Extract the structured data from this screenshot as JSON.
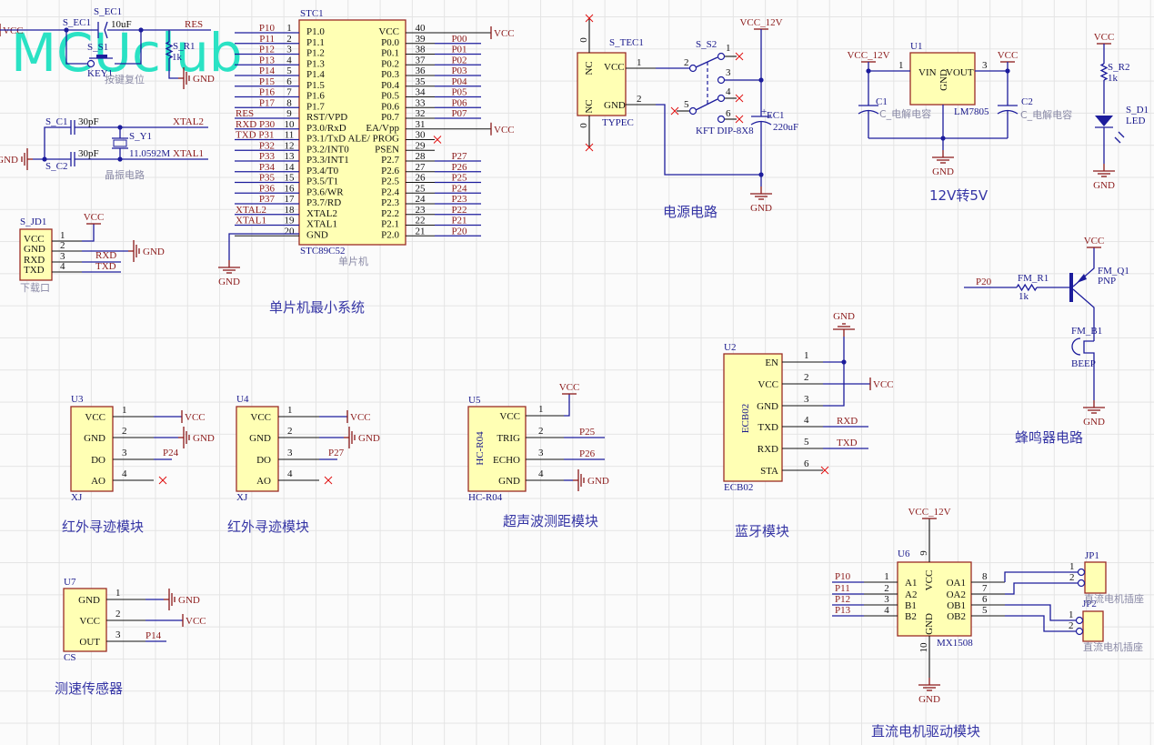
{
  "watermark": "MCUclub",
  "titles": {
    "mcu_system": "单片机最小系统",
    "power": "电源电路",
    "regulator": "12V转5V",
    "buzzer": "蜂鸣器电路",
    "ir1": "红外寻迹模块",
    "ir2": "红外寻迹模块",
    "ultrasonic": "超声波测距模块",
    "bluetooth": "蓝牙模块",
    "speed": "测速传感器",
    "motor": "直流电机驱动模块"
  },
  "reset": {
    "vcc": "VCC",
    "cap": "S_EC1",
    "cap_val": "10uF",
    "net": "RES",
    "switch": "S_S1",
    "switch_part": "KEY1",
    "res": "S_R1",
    "res_val": "1k",
    "gnd": "GND",
    "caption": "按键复位"
  },
  "crystal": {
    "c1": "S_C1",
    "c1_val": "30pF",
    "c2": "S_C2",
    "c2_val": "30pF",
    "xtal": "S_Y1",
    "xtal_val": "11.0592M",
    "net2": "XTAL2",
    "net1": "XTAL1",
    "gnd": "GND",
    "caption": "晶振电路"
  },
  "jd1": {
    "ref": "S_JD1",
    "caption": "下载口",
    "vcc": "VCC",
    "gnd": "GND",
    "rxd": "RXD",
    "txd": "TXD",
    "pins": [
      {
        "n": "1",
        "name": "VCC"
      },
      {
        "n": "2",
        "name": "GND"
      },
      {
        "n": "3",
        "name": "RXD"
      },
      {
        "n": "4",
        "name": "TXD"
      }
    ]
  },
  "mcu": {
    "ref": "STC1",
    "part": "STC89C52",
    "caption": "单片机",
    "gnd": "GND",
    "left": [
      {
        "n": "1",
        "name": "P1.0",
        "net": "P10"
      },
      {
        "n": "2",
        "name": "P1.1",
        "net": "P11"
      },
      {
        "n": "3",
        "name": "P1.2",
        "net": "P12"
      },
      {
        "n": "4",
        "name": "P1.3",
        "net": "P13"
      },
      {
        "n": "5",
        "name": "P1.4",
        "net": "P14"
      },
      {
        "n": "6",
        "name": "P1.5",
        "net": "P15"
      },
      {
        "n": "7",
        "name": "P1.6",
        "net": "P16"
      },
      {
        "n": "8",
        "name": "P1.7",
        "net": "P17"
      },
      {
        "n": "9",
        "name": "RST/VPD",
        "net": "RES"
      },
      {
        "n": "10",
        "name": "P3.0/RxD",
        "net": "RXD P30"
      },
      {
        "n": "11",
        "name": "P3.1/TxD",
        "net": "TXD P31"
      },
      {
        "n": "12",
        "name": "P3.2/INT0",
        "net": "P32"
      },
      {
        "n": "13",
        "name": "P3.3/INT1",
        "net": "P33"
      },
      {
        "n": "14",
        "name": "P3.4/T0",
        "net": "P34"
      },
      {
        "n": "15",
        "name": "P3.5/T1",
        "net": "P35"
      },
      {
        "n": "16",
        "name": "P3.6/WR",
        "net": "P36"
      },
      {
        "n": "17",
        "name": "P3.7/RD",
        "net": "P37"
      },
      {
        "n": "18",
        "name": "XTAL2",
        "net": "XTAL2"
      },
      {
        "n": "19",
        "name": "XTAL1",
        "net": "XTAL1"
      },
      {
        "n": "20",
        "name": "GND",
        "net": ""
      }
    ],
    "right": [
      {
        "n": "40",
        "name": "VCC",
        "net": "VCC"
      },
      {
        "n": "39",
        "name": "P0.0",
        "net": "P00"
      },
      {
        "n": "38",
        "name": "P0.1",
        "net": "P01"
      },
      {
        "n": "37",
        "name": "P0.2",
        "net": "P02"
      },
      {
        "n": "36",
        "name": "P0.3",
        "net": "P03"
      },
      {
        "n": "35",
        "name": "P0.4",
        "net": "P04"
      },
      {
        "n": "34",
        "name": "P0.5",
        "net": "P05"
      },
      {
        "n": "33",
        "name": "P0.6",
        "net": "P06"
      },
      {
        "n": "32",
        "name": "P0.7",
        "net": "P07"
      },
      {
        "n": "31",
        "name": "EA/Vpp",
        "net": "VCC"
      },
      {
        "n": "30",
        "name": "ALE/ PROG",
        "net": ""
      },
      {
        "n": "29",
        "name": "PSEN",
        "net": ""
      },
      {
        "n": "28",
        "name": "P2.7",
        "net": "P27"
      },
      {
        "n": "27",
        "name": "P2.6",
        "net": "P26"
      },
      {
        "n": "26",
        "name": "P2.5",
        "net": "P25"
      },
      {
        "n": "25",
        "name": "P2.4",
        "net": "P24"
      },
      {
        "n": "24",
        "name": "P2.3",
        "net": "P23"
      },
      {
        "n": "23",
        "name": "P2.2",
        "net": "P22"
      },
      {
        "n": "22",
        "name": "P2.1",
        "net": "P21"
      },
      {
        "n": "21",
        "name": "P2.0",
        "net": "P20"
      }
    ]
  },
  "power": {
    "ref": "S_TEC1",
    "part": "TYPEC",
    "nc": "NC",
    "zero": "0",
    "pins": [
      {
        "n": "1",
        "name": "VCC"
      },
      {
        "n": "2",
        "name": "GND"
      }
    ],
    "switch": "S_S2",
    "switch_part": "KFT DIP-8X8",
    "switch_pins": [
      "1",
      "2",
      "3",
      "4",
      "5",
      "6"
    ],
    "cap": "EC1",
    "cap_val": "220uF",
    "vcc12": "VCC_12V",
    "gnd": "GND"
  },
  "reg": {
    "ref": "U1",
    "part": "LM7805",
    "vin": "VIN",
    "vout": "VOUT",
    "gnd_pin": "GND",
    "pin1": "1",
    "pin3": "3",
    "vin_net": "VCC_12V",
    "vout_net": "VCC",
    "c1": "C1",
    "c1_val": "C_电解电容",
    "c2": "C2",
    "c2_val": "C_电解电容",
    "gnd": "GND"
  },
  "led": {
    "vcc": "VCC",
    "res": "S_R2",
    "res_val": "1k",
    "led": "S_D1",
    "led_val": "LED",
    "gnd": "GND"
  },
  "buzzer": {
    "net": "P20",
    "res": "FM_R1",
    "res_val": "1k",
    "q": "FM_Q1",
    "q_val": "PNP",
    "vcc": "VCC",
    "b": "FM_B1",
    "b_val": "BEEP",
    "gnd": "GND"
  },
  "bt": {
    "ref": "U2",
    "part": "ECB02",
    "body": "ECB02",
    "gnd": "GND",
    "pins": [
      {
        "n": "1",
        "name": "EN",
        "net": ""
      },
      {
        "n": "2",
        "name": "VCC",
        "net": "VCC"
      },
      {
        "n": "3",
        "name": "GND",
        "net": ""
      },
      {
        "n": "4",
        "name": "TXD",
        "net": "RXD"
      },
      {
        "n": "5",
        "name": "RXD",
        "net": "TXD"
      },
      {
        "n": "6",
        "name": "STA",
        "net": ""
      }
    ]
  },
  "u3": {
    "ref": "U3",
    "part": "XJ",
    "pins": [
      {
        "n": "1",
        "name": "VCC",
        "net": "VCC"
      },
      {
        "n": "2",
        "name": "GND",
        "net": "GND"
      },
      {
        "n": "3",
        "name": "DO",
        "net": "P24"
      },
      {
        "n": "4",
        "name": "AO",
        "net": ""
      }
    ]
  },
  "u4": {
    "ref": "U4",
    "part": "XJ",
    "pins": [
      {
        "n": "1",
        "name": "VCC",
        "net": "VCC"
      },
      {
        "n": "2",
        "name": "GND",
        "net": "GND"
      },
      {
        "n": "3",
        "name": "DO",
        "net": "P27"
      },
      {
        "n": "4",
        "name": "AO",
        "net": ""
      }
    ]
  },
  "u5": {
    "ref": "U5",
    "part": "HC-R04",
    "body": "HC-R04",
    "pins": [
      {
        "n": "1",
        "name": "VCC",
        "net": "VCC"
      },
      {
        "n": "2",
        "name": "TRIG",
        "net": "P25"
      },
      {
        "n": "3",
        "name": "ECHO",
        "net": "P26"
      },
      {
        "n": "4",
        "name": "GND",
        "net": "GND"
      }
    ]
  },
  "u7": {
    "ref": "U7",
    "part": "CS",
    "pins": [
      {
        "n": "1",
        "name": "GND",
        "net": "GND"
      },
      {
        "n": "2",
        "name": "VCC",
        "net": "VCC"
      },
      {
        "n": "3",
        "name": "OUT",
        "net": "P14"
      }
    ]
  },
  "u6": {
    "ref": "U6",
    "part": "MX1508",
    "vcc_pin": "VCC",
    "gnd_pin": "GND",
    "vcc_n": "9",
    "gnd_n": "10",
    "vcc_net": "VCC_12V",
    "gnd": "GND",
    "left": [
      {
        "n": "1",
        "name": "A1",
        "net": "P10"
      },
      {
        "n": "2",
        "name": "A2",
        "net": "P11"
      },
      {
        "n": "3",
        "name": "B1",
        "net": "P12"
      },
      {
        "n": "4",
        "name": "B2",
        "net": "P13"
      }
    ],
    "right": [
      {
        "n": "8",
        "name": "OA1"
      },
      {
        "n": "7",
        "name": "OA2"
      },
      {
        "n": "6",
        "name": "OB1"
      },
      {
        "n": "5",
        "name": "OB2"
      }
    ],
    "jp1": {
      "ref": "JP1",
      "caption": "直流电机插座",
      "pins": [
        "1",
        "2"
      ]
    },
    "jp2": {
      "ref": "JP2",
      "caption": "直流电机插座",
      "pins": [
        "1",
        "2"
      ]
    }
  },
  "colors": {
    "wire": "#1c1c9c",
    "net_label": "#8b1a1a",
    "component_body": "#ffffb4",
    "component_border": "#9b2b25",
    "designator": "#1a1a8c",
    "no_connect": "#e01010",
    "watermark": "#19e0c0"
  }
}
